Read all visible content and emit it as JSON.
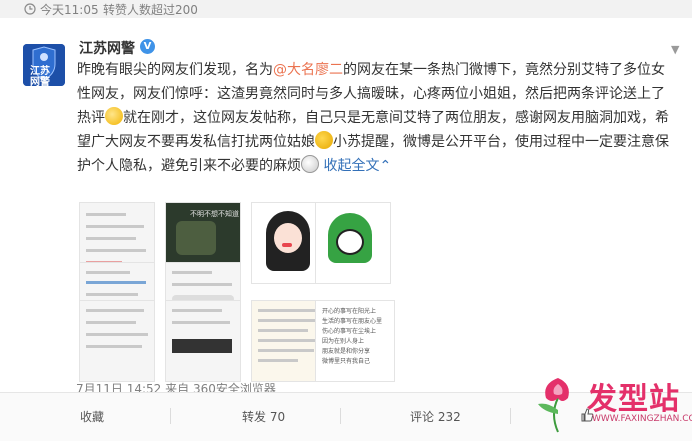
{
  "topbar": {
    "time": "今天11:05",
    "forward_likes": "转赞人数超过200"
  },
  "account": {
    "name": "江苏网警",
    "verified": "V",
    "avatar_text_1": "江苏",
    "avatar_text_2": "网警"
  },
  "post": {
    "seg1": "昨晚有眼尖的网友们发现，名为",
    "mention": "@大名廖二",
    "seg2": "的网友在某一条热门微博下，竟然分别艾特了多位女性网友，网友们惊呼：这渣男竟然同时与多人搞暧昧，心疼两位小姐姐，然后把两条评论送上了热评",
    "seg3": "就在刚才，这位网友发帖称，自己只是无意间艾特了两位朋友，感谢网友用脑洞加戏，希望广大网友不要再发私信打扰两位姑娘",
    "seg4": "小苏提醒，微博是公开平台，使用过程中一定要注意保护个人隐私，避免引来不必要的麻烦",
    "collapse": "收起全文",
    "collapse_arrow": "⌃"
  },
  "thumbnails": {
    "t2_caption": "不明不想不知道",
    "t7_lines": [
      "开心的事写在阳光上",
      "生活的事写在朋友心里",
      "伤心的事写在尘埃上",
      "因为在别人身上",
      "朋友就是和你分享",
      "微博里只有我自己"
    ]
  },
  "meta": {
    "date": "7月11日 14:52",
    "from": "来自",
    "client": "360安全浏览器"
  },
  "actions": {
    "collect": "收藏",
    "forward": "转发 70",
    "comment": "评论 232",
    "like_icon": "thumbs-up-icon"
  },
  "watermark": {
    "text": "发型站",
    "url": "WWW.FAXINGZHAN.COM"
  },
  "colors": {
    "mention": "#eb7350",
    "link": "#3370b8",
    "badge": "#3f93e8"
  }
}
